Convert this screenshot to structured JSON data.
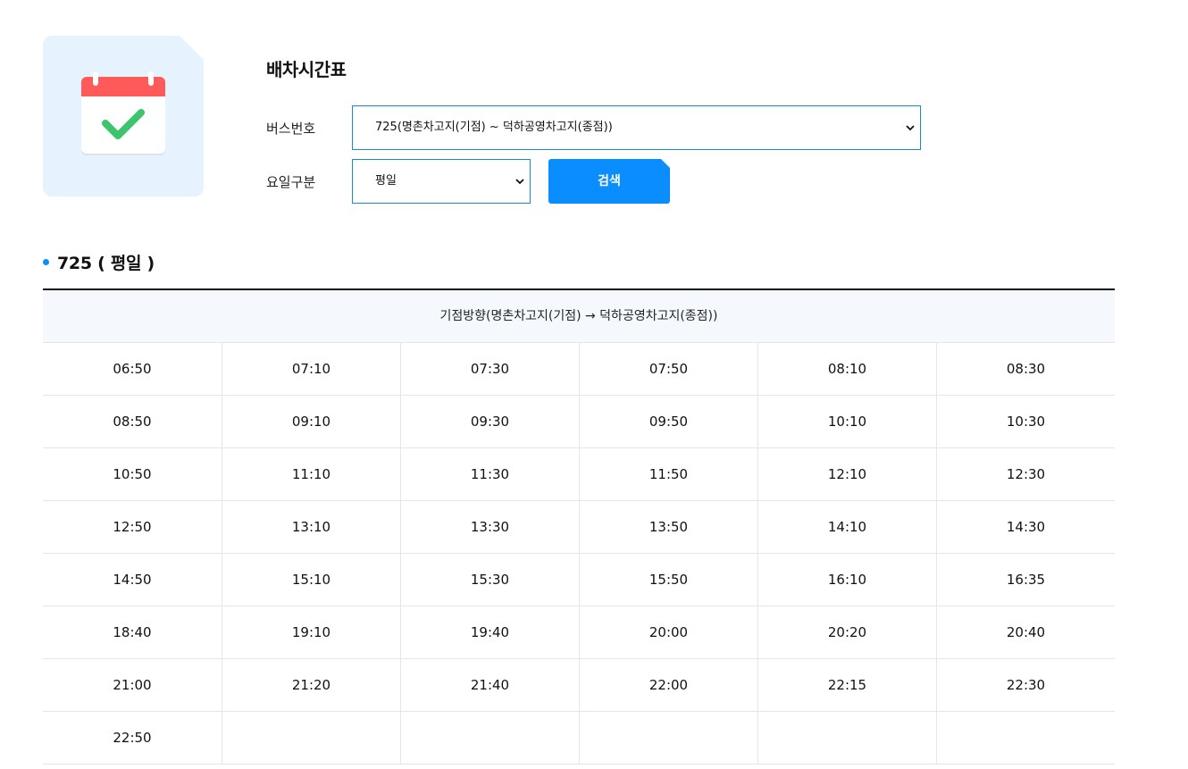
{
  "page": {
    "title": "배차시간표",
    "icon": "calendar-check-icon",
    "colors": {
      "accent": "#0a8dff",
      "border": "#1a8bc9",
      "calendar_red": "#ff5a5a",
      "check_green": "#3ec46d"
    }
  },
  "form": {
    "bus_label": "버스번호",
    "bus_value": "725(명촌차고지(기점) ~ 덕하공영차고지(종점))",
    "day_label": "요일구분",
    "day_value": "평일",
    "search_label": "검색"
  },
  "result": {
    "title": "725 ( 평일 )",
    "direction": "기점방향(명촌차고지(기점) → 덕하공영차고지(종점))",
    "times": [
      "06:50",
      "07:10",
      "07:30",
      "07:50",
      "08:10",
      "08:30",
      "08:50",
      "09:10",
      "09:30",
      "09:50",
      "10:10",
      "10:30",
      "10:50",
      "11:10",
      "11:30",
      "11:50",
      "12:10",
      "12:30",
      "12:50",
      "13:10",
      "13:30",
      "13:50",
      "14:10",
      "14:30",
      "14:50",
      "15:10",
      "15:30",
      "15:50",
      "16:10",
      "16:35",
      "18:40",
      "19:10",
      "19:40",
      "20:00",
      "20:20",
      "20:40",
      "21:00",
      "21:20",
      "21:40",
      "22:00",
      "22:15",
      "22:30",
      "22:50",
      "",
      "",
      "",
      "",
      ""
    ]
  }
}
